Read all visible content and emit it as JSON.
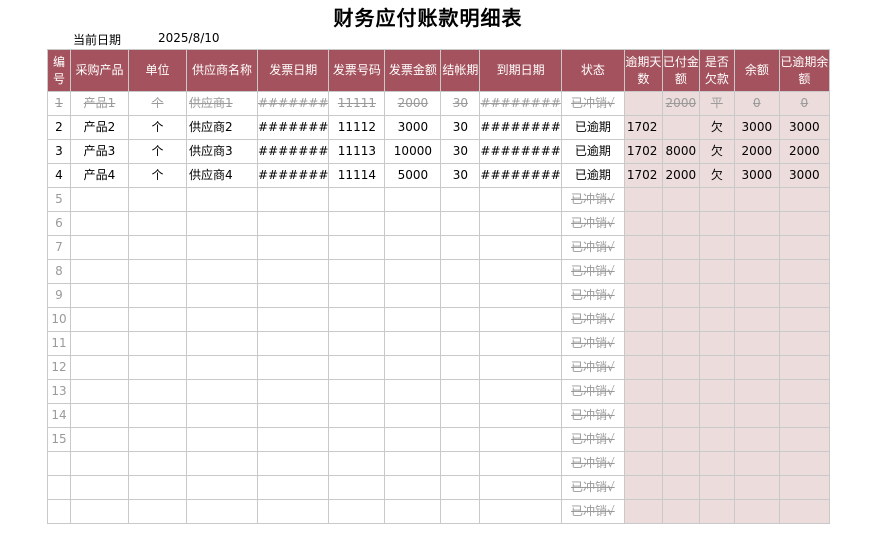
{
  "title": "财务应付账款明细表",
  "date_label": "当前日期",
  "date_value": "2025/8/10",
  "colors": {
    "header_bg": "#a4525d",
    "highlight_bg": "#ecdcdc"
  },
  "headers": [
    "编号",
    "采购产品",
    "单位",
    "供应商名称",
    "发票日期",
    "发票号码",
    "发票金额",
    "结帐期",
    "到期日期",
    "状态",
    "逾期天数",
    "已付金额",
    "是否欠款",
    "余额",
    "已逾期余额"
  ],
  "rows": [
    {
      "no": "1",
      "product": "产品1",
      "unit": "个",
      "supplier": "供应商1",
      "inv_date": "#######",
      "inv_no": "11111",
      "amount": "2000",
      "term": "30",
      "due": "########",
      "status": "已冲销√",
      "overdue_days": "",
      "paid": "2000",
      "owed": "平",
      "balance": "0",
      "overdue_balance": "0",
      "state": "paid"
    },
    {
      "no": "2",
      "product": "产品2",
      "unit": "个",
      "supplier": "供应商2",
      "inv_date": "#######",
      "inv_no": "11112",
      "amount": "3000",
      "term": "30",
      "due": "########",
      "status": "已逾期",
      "overdue_days": "1702",
      "paid": "",
      "owed": "欠",
      "balance": "3000",
      "overdue_balance": "3000",
      "state": "open"
    },
    {
      "no": "3",
      "product": "产品3",
      "unit": "个",
      "supplier": "供应商3",
      "inv_date": "#######",
      "inv_no": "11113",
      "amount": "10000",
      "term": "30",
      "due": "########",
      "status": "已逾期",
      "overdue_days": "1702",
      "paid": "8000",
      "owed": "欠",
      "balance": "2000",
      "overdue_balance": "2000",
      "state": "open"
    },
    {
      "no": "4",
      "product": "产品4",
      "unit": "个",
      "supplier": "供应商4",
      "inv_date": "#######",
      "inv_no": "11114",
      "amount": "5000",
      "term": "30",
      "due": "########",
      "status": "已逾期",
      "overdue_days": "1702",
      "paid": "2000",
      "owed": "欠",
      "balance": "3000",
      "overdue_balance": "3000",
      "state": "open"
    },
    {
      "no": "5",
      "status": "已冲销√",
      "state": "empty"
    },
    {
      "no": "6",
      "status": "已冲销√",
      "state": "empty"
    },
    {
      "no": "7",
      "status": "已冲销√",
      "state": "empty"
    },
    {
      "no": "8",
      "status": "已冲销√",
      "state": "empty"
    },
    {
      "no": "9",
      "status": "已冲销√",
      "state": "empty"
    },
    {
      "no": "10",
      "status": "已冲销√",
      "state": "empty"
    },
    {
      "no": "11",
      "status": "已冲销√",
      "state": "empty"
    },
    {
      "no": "12",
      "status": "已冲销√",
      "state": "empty"
    },
    {
      "no": "13",
      "status": "已冲销√",
      "state": "empty"
    },
    {
      "no": "14",
      "status": "已冲销√",
      "state": "empty"
    },
    {
      "no": "15",
      "status": "已冲销√",
      "state": "empty"
    },
    {
      "no": "",
      "status": "已冲销√",
      "state": "empty"
    },
    {
      "no": "",
      "status": "已冲销√",
      "state": "empty"
    },
    {
      "no": "",
      "status": "已冲销√",
      "state": "empty"
    }
  ]
}
